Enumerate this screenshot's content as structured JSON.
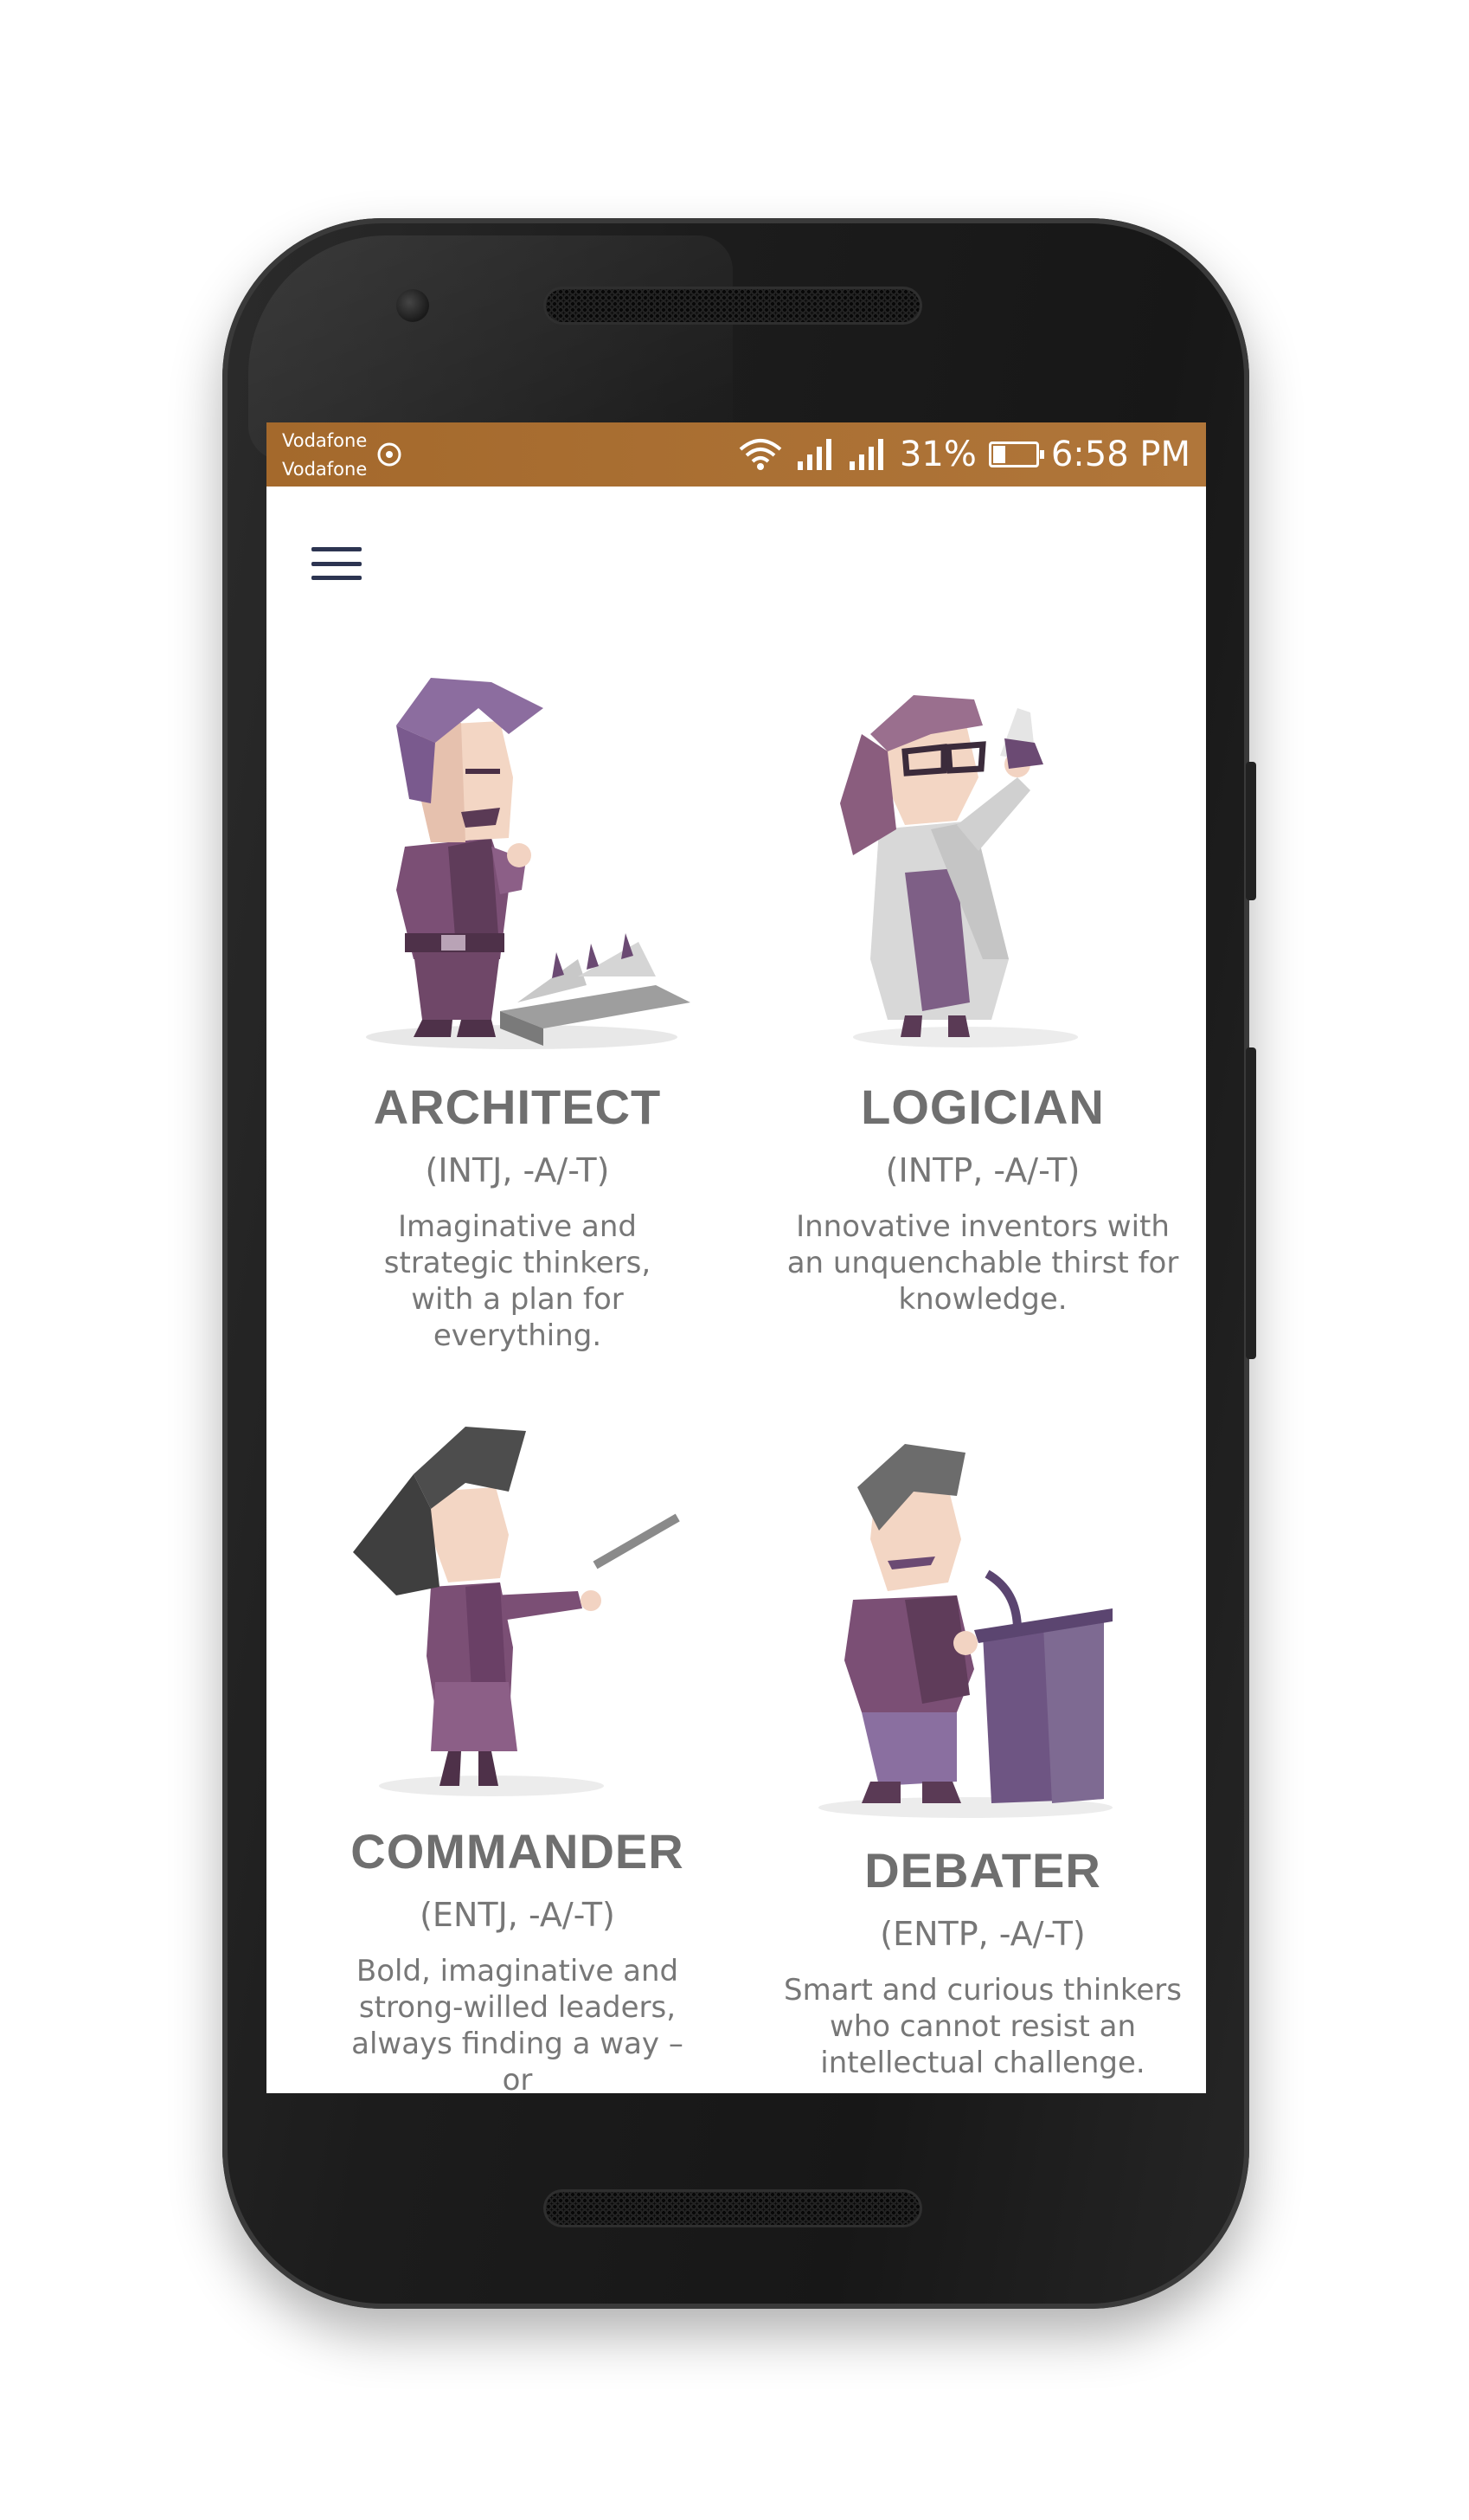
{
  "status_bar": {
    "carrier_1": "Vodafone",
    "carrier_2": "Vodafone",
    "battery_percent": "31%",
    "time": "6:58 PM"
  },
  "personalities": [
    {
      "name": "ARCHITECT",
      "code": "(INTJ, -A/-T)",
      "description": "Imaginative and strategic thinkers, with a plan for everything."
    },
    {
      "name": "LOGICIAN",
      "code": "(INTP, -A/-T)",
      "description": "Innovative inventors with an unquenchable thirst for knowledge."
    },
    {
      "name": "COMMANDER",
      "code": "(ENTJ, -A/-T)",
      "description": "Bold, imaginative and strong-willed leaders, always finding a way – or"
    },
    {
      "name": "DEBATER",
      "code": "(ENTP, -A/-T)",
      "description": "Smart and curious thinkers who cannot resist an intellectual challenge."
    }
  ],
  "colors": {
    "status_bar": "#a96f32",
    "menu_icon": "#2c3451",
    "purple": "#7e5f86",
    "heading_gray": "#6f6f6f"
  }
}
